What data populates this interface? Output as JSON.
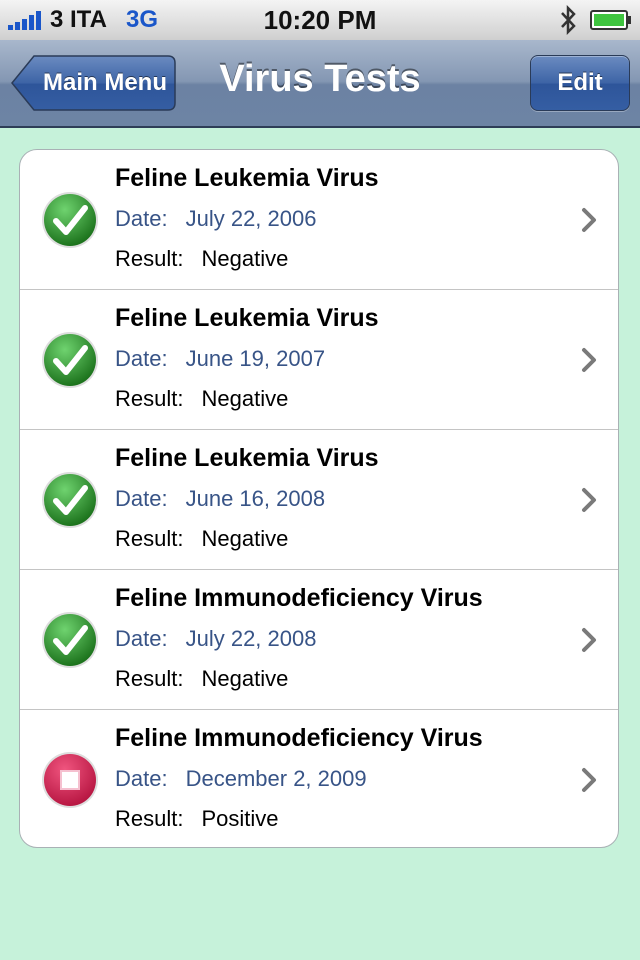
{
  "status_bar": {
    "carrier": "3 ITA",
    "network": "3G",
    "time": "10:20 PM",
    "icons": [
      "signal-bars-icon",
      "bluetooth-icon",
      "battery-icon"
    ]
  },
  "nav": {
    "back_label": "Main Menu",
    "title": "Virus Tests",
    "edit_label": "Edit"
  },
  "date_label": "Date:",
  "result_label": "Result:",
  "tests": [
    {
      "name": "Feline Leukemia Virus",
      "date": "July 22, 2006",
      "result": "Negative",
      "status_icon": "check-icon"
    },
    {
      "name": "Feline Leukemia Virus",
      "date": "June 19, 2007",
      "result": "Negative",
      "status_icon": "check-icon"
    },
    {
      "name": "Feline Leukemia Virus",
      "date": "June 16, 2008",
      "result": "Negative",
      "status_icon": "check-icon"
    },
    {
      "name": "Feline Immunodeficiency Virus",
      "date": "July 22, 2008",
      "result": "Negative",
      "status_icon": "check-icon"
    },
    {
      "name": "Feline Immunodeficiency Virus",
      "date": "December 2, 2009",
      "result": "Positive",
      "status_icon": "stop-icon"
    }
  ],
  "colors": {
    "background": "#c6f2da",
    "date_text": "#385487",
    "negative_icon": "#1f8a1f",
    "positive_icon": "#d2174a"
  }
}
